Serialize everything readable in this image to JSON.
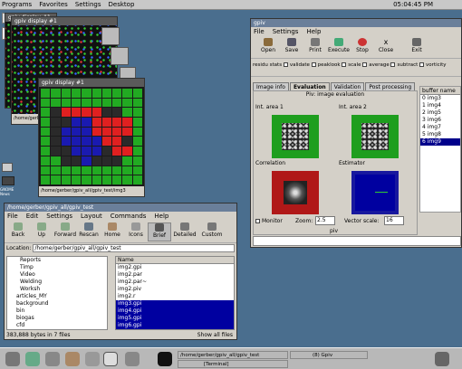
{
  "topbar": {
    "menus": [
      "Programs",
      "Favorites",
      "Settings",
      "Desktop"
    ],
    "clock": "05:04:45 PM"
  },
  "desktop_icons": {
    "gnome_label": "GNOME News"
  },
  "image_windows": {
    "titles": [
      "gpiv display #1",
      "gpiv display #1",
      "gpiv display #1"
    ],
    "caption": "/home/gerber/gpiv_all/gpiv_test/img3",
    "caption_short": "/home/gerb"
  },
  "gpiv": {
    "title": "gpiv",
    "menu": [
      "File",
      "Settings",
      "Help"
    ],
    "toolbar": [
      "Open",
      "Save",
      "Print",
      "Execute",
      "Stop",
      "Close",
      "Exit"
    ],
    "checks": [
      "residu stats",
      "validate",
      "peaklook",
      "scale",
      "average",
      "subtract",
      "vorticity"
    ],
    "tabs": [
      "Image info",
      "Evaluation",
      "Validation",
      "Post processing"
    ],
    "panel_title": "Piv: image evaluation",
    "int_area_1": "Int. area 1",
    "int_area_2": "Int. area 2",
    "correlation": "Correlation",
    "estimator": "Estimator",
    "monitor": "Monitor",
    "zoom_label": "Zoom:",
    "zoom_value": "2.5",
    "vscale_label": "Vector scale:",
    "vscale_value": "16",
    "status": "piv",
    "buffer_header": "buffer name",
    "buffers": [
      {
        "n": "0",
        "name": "img3"
      },
      {
        "n": "1",
        "name": "img4"
      },
      {
        "n": "2",
        "name": "img5"
      },
      {
        "n": "3",
        "name": "img6"
      },
      {
        "n": "4",
        "name": "img7"
      },
      {
        "n": "5",
        "name": "img8"
      },
      {
        "n": "6",
        "name": "img9"
      }
    ]
  },
  "fm": {
    "title": "/home/gerber/gpiv_all/gpiv_test",
    "menu": [
      "File",
      "Edit",
      "Settings",
      "Layout",
      "Commands",
      "Help"
    ],
    "toolbar": [
      "Back",
      "Up",
      "Forward",
      "Rescan",
      "Home",
      "Icons",
      "Brief",
      "Detailed",
      "Custom"
    ],
    "location_label": "Location:",
    "location": "/home/gerber/gpiv_all/gpiv_test",
    "tree": [
      "Reports",
      "Timp",
      "Video",
      "Welding",
      "Worksh",
      "articles_MY",
      "background",
      "bin",
      "biogas",
      "cfd",
      "..."
    ],
    "list_header": "Name",
    "files": [
      {
        "name": "img2.gpi",
        "sel": false
      },
      {
        "name": "img2.par",
        "sel": false
      },
      {
        "name": "img2.par~",
        "sel": false
      },
      {
        "name": "img2.piv",
        "sel": false
      },
      {
        "name": "img2.r",
        "sel": false
      },
      {
        "name": "img3.gpi",
        "sel": true
      },
      {
        "name": "img4.gpi",
        "sel": true
      },
      {
        "name": "img5.gpi",
        "sel": true
      },
      {
        "name": "img6.gpi",
        "sel": true
      }
    ],
    "status_left": "383,888 bytes in 7 files",
    "status_right": "Show all files"
  },
  "taskbar": {
    "item1": "/home/gerber/gpiv_all/gpiv_test",
    "item2": "(8) Gpiv",
    "item3": "[Terminal]"
  },
  "colors": {
    "select": "#0000a0",
    "titlebar": "#6a7f9a",
    "desktop": "#4a6e8e"
  }
}
